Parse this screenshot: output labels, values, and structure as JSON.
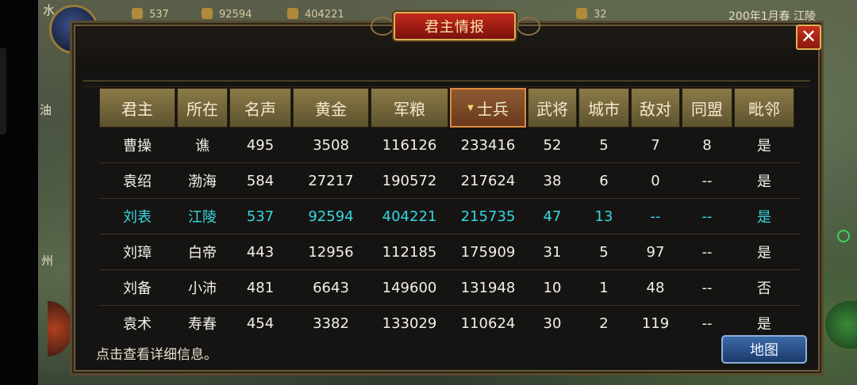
{
  "topbar": {
    "res1": "537",
    "res2": "92594",
    "res3": "404221",
    "res4": "32",
    "date": "200年1月春 江陵"
  },
  "map_labels": {
    "water": "水",
    "oil": "油",
    "zhou": "州"
  },
  "panel": {
    "title": "君主情报",
    "close": "✕",
    "hint": "点击查看详细信息。",
    "map_button": "地图"
  },
  "table": {
    "columns": [
      "君主",
      "所在",
      "名声",
      "黄金",
      "军粮",
      "士兵",
      "武将",
      "城市",
      "敌对",
      "同盟",
      "毗邻"
    ],
    "sorted_column": "士兵",
    "rows": [
      [
        "曹操",
        "谯",
        "495",
        "3508",
        "116126",
        "233416",
        "52",
        "5",
        "7",
        "8",
        "是"
      ],
      [
        "袁绍",
        "渤海",
        "584",
        "27217",
        "190572",
        "217624",
        "38",
        "6",
        "0",
        "--",
        "是"
      ],
      [
        "刘表",
        "江陵",
        "537",
        "92594",
        "404221",
        "215735",
        "47",
        "13",
        "--",
        "--",
        "是"
      ],
      [
        "刘璋",
        "白帝",
        "443",
        "12956",
        "112185",
        "175909",
        "31",
        "5",
        "97",
        "--",
        "是"
      ],
      [
        "刘备",
        "小沛",
        "481",
        "6643",
        "149600",
        "131948",
        "10",
        "1",
        "48",
        "--",
        "否"
      ],
      [
        "袁术",
        "寿春",
        "454",
        "3382",
        "133029",
        "110624",
        "30",
        "2",
        "119",
        "--",
        "是"
      ]
    ],
    "highlight_row": 2,
    "highlight_color": "#35d8e0"
  }
}
